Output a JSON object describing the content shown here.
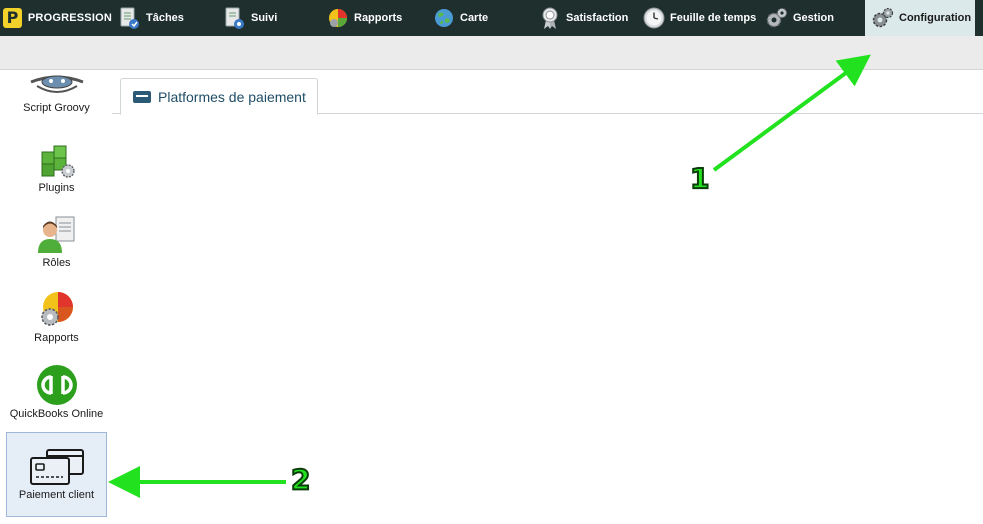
{
  "brand": {
    "logo_letter": "P",
    "name": "PROGRESSION"
  },
  "topnav": {
    "items": [
      {
        "label": "Tâches",
        "icon": "tasks-icon"
      },
      {
        "label": "Suivi",
        "icon": "tracking-icon"
      },
      {
        "label": "Rapports",
        "icon": "reports-icon"
      },
      {
        "label": "Carte",
        "icon": "globe-icon"
      },
      {
        "label": "Satisfaction",
        "icon": "award-icon"
      },
      {
        "label": "Feuille de temps",
        "icon": "clock-icon"
      },
      {
        "label": "Gestion",
        "icon": "gears-icon"
      },
      {
        "label": "Configuration",
        "icon": "gears-icon",
        "active": true
      }
    ]
  },
  "sidebar": {
    "items": [
      {
        "label": "Script Groovy",
        "icon": "groovy-logo-icon"
      },
      {
        "label": "Plugins",
        "icon": "plugins-icon"
      },
      {
        "label": "Rôles",
        "icon": "roles-icon"
      },
      {
        "label": "Rapports",
        "icon": "reports-icon"
      },
      {
        "label": "QuickBooks Online",
        "icon": "quickbooks-icon"
      },
      {
        "label": "Paiement client",
        "icon": "credit-cards-icon",
        "selected": true
      }
    ]
  },
  "main": {
    "tab": {
      "label": "Platformes de paiement",
      "icon": "credit-card-icon"
    }
  },
  "annotations": [
    {
      "number": "1",
      "points_to": "Configuration"
    },
    {
      "number": "2",
      "points_to": "Paiement client"
    }
  ],
  "colors": {
    "nav_bg": "#1e2f2e",
    "nav_active_bg": "#dbe9ea",
    "annotation_green": "#22e21f",
    "brand_yellow": "#f2d12b",
    "tab_text": "#1f4d66"
  }
}
